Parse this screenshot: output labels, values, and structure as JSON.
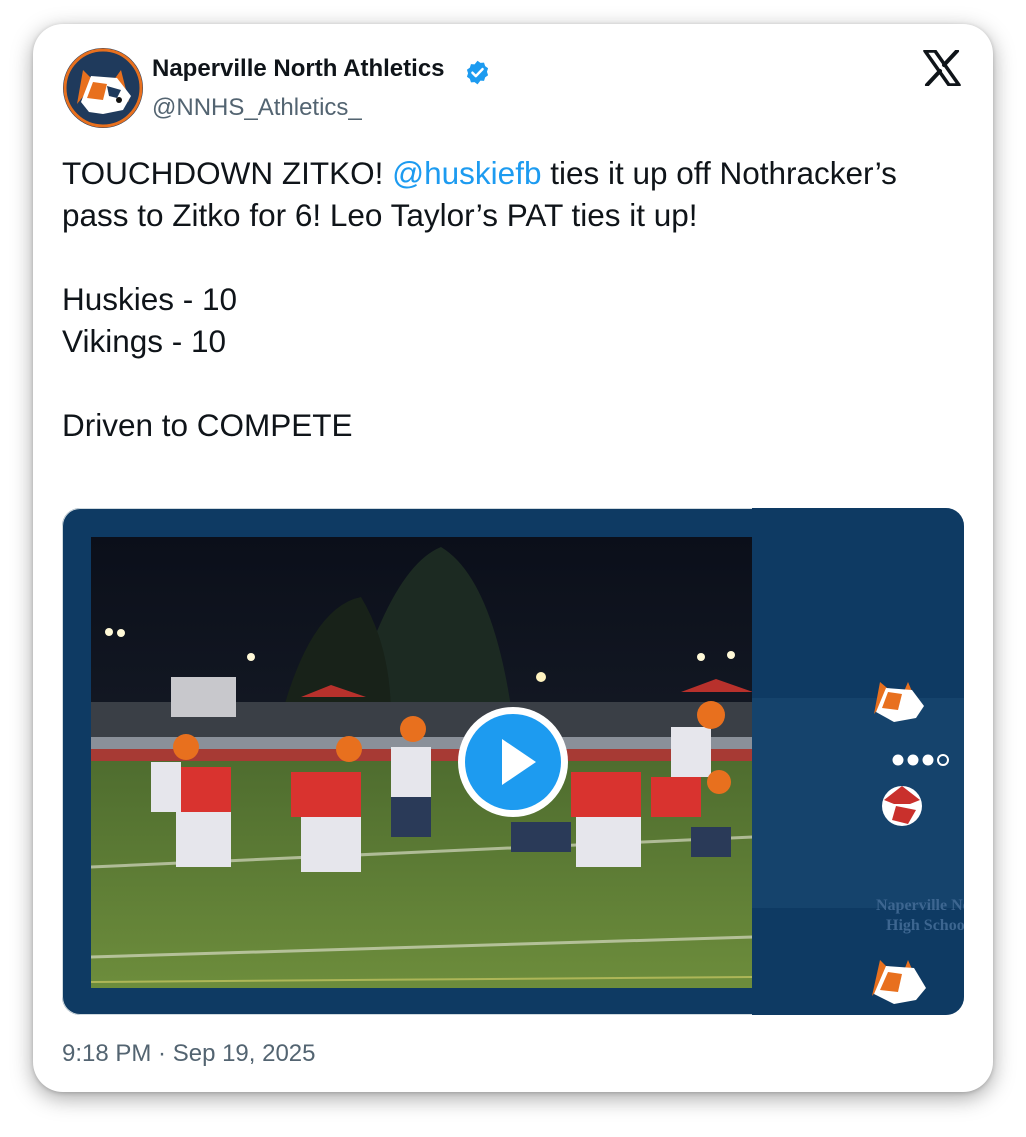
{
  "author": {
    "name": "Naperville North Athletics",
    "handle": "@NNHS_Athletics_",
    "verified": true,
    "avatar_icon": "husky-mascot-icon"
  },
  "platform_icon": "x-logo-icon",
  "tweet": {
    "line1_before": "TOUCHDOWN ZITKO!  ",
    "mention": "@huskiefb",
    "line1_after": " ties it up off Nothracker’s pass to Zitko for 6!  Leo Taylor’s PAT ties it up!",
    "score_home": "Huskies - 10",
    "score_away": "Vikings - 10",
    "slogan": "Driven to COMPETE"
  },
  "media": {
    "type": "video",
    "overlay_text_line1": "Naperville North",
    "overlay_text_line2": "High School",
    "play_icon": "play-icon"
  },
  "timestamp": "9:18 PM · Sep 19, 2025",
  "colors": {
    "mention": "#1d9bf0",
    "verified": "#1d9bf0",
    "media_panel": "#0e3a63",
    "husky_orange": "#e8701e"
  }
}
